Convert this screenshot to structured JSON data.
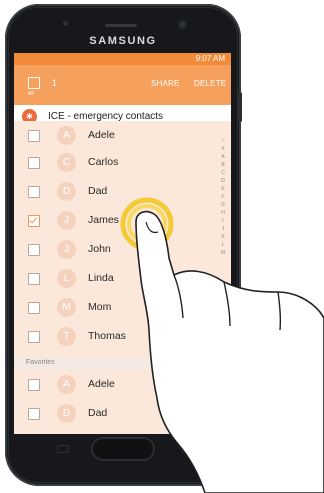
{
  "device": {
    "brand": "SAMSUNG"
  },
  "status_bar": {
    "time": "9:07 AM",
    "icons": "signal-icon battery-icon"
  },
  "app_bar": {
    "all_label": "All",
    "selected_count": "1",
    "share_label": "SHARE",
    "delete_label": "DELETE"
  },
  "ice": {
    "label": "ICE - emergency contacts",
    "icon": "emergency-icon"
  },
  "contacts": [
    {
      "initial": "A",
      "name": "Adele",
      "checked": false
    },
    {
      "initial": "C",
      "name": "Carlos",
      "checked": false
    },
    {
      "initial": "D",
      "name": "Dad",
      "checked": false
    },
    {
      "initial": "J",
      "name": "James",
      "checked": true
    },
    {
      "initial": "J",
      "name": "John",
      "checked": false
    },
    {
      "initial": "L",
      "name": "Linda",
      "checked": false
    },
    {
      "initial": "M",
      "name": "Mom",
      "checked": false
    },
    {
      "initial": "T",
      "name": "Thomas",
      "checked": false
    }
  ],
  "favorites": {
    "header": "Favorites",
    "items": [
      {
        "initial": "A",
        "name": "Adele",
        "checked": false
      },
      {
        "initial": "D",
        "name": "Dad",
        "checked": false
      }
    ]
  },
  "index_letters": [
    "☆",
    "#",
    "A",
    "B",
    "C",
    "D",
    "E",
    "F",
    "G",
    "H",
    "I",
    "J",
    "K",
    "L",
    "M"
  ],
  "colors": {
    "accent": "#f5a05c",
    "status_bar": "#f28b39",
    "list_bg": "#fbe8da",
    "avatar": "#f4d2bd",
    "tap_ring": "#f3c623"
  }
}
